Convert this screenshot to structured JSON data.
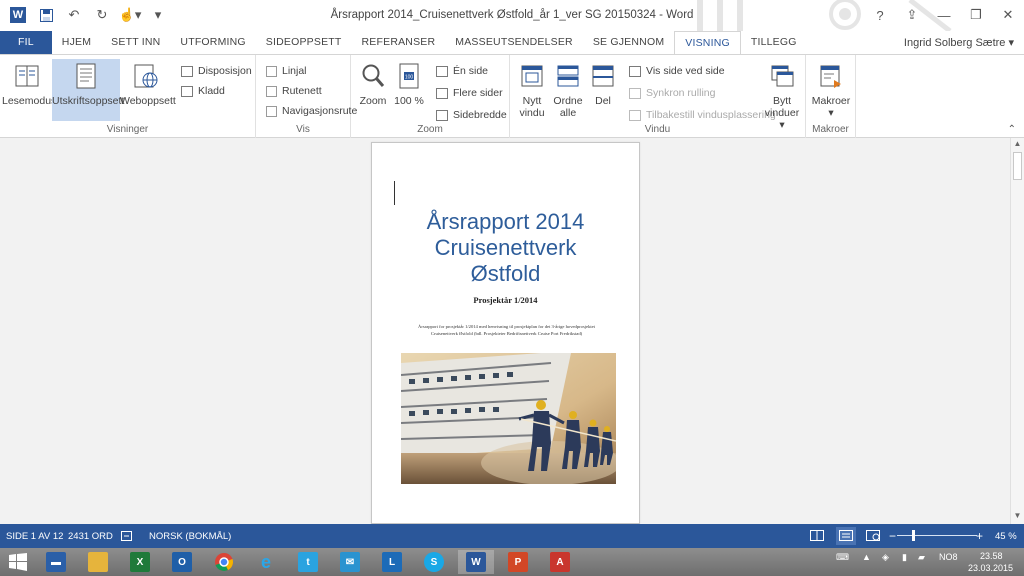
{
  "window": {
    "title": "Årsrapport 2014_Cruisenettverk Østfold_år 1_ver SG 20150324 - Word",
    "buttons": {
      "help": "?",
      "ribbon_display": "⇪",
      "minimize": "—",
      "maximize": "❐",
      "close": "✕"
    }
  },
  "qat": {
    "word_logo": "W",
    "save_icon": "save-icon",
    "undo": "↶",
    "redo": "↻",
    "touch": "☝▾",
    "customize": "▾"
  },
  "tabs": [
    "FIL",
    "HJEM",
    "SETT INN",
    "UTFORMING",
    "SIDEOPPSETT",
    "REFERANSER",
    "MASSEUTSENDELSER",
    "SE GJENNOM",
    "VISNING",
    "TILLEGG"
  ],
  "active_tab": "VISNING",
  "user": "Ingrid Solberg Sætre ▾",
  "ribbon": {
    "visninger": {
      "label": "Visninger",
      "lesemodus": "Lesemodus",
      "utskrift": "Utskriftsoppsett",
      "web": "Weboppsett",
      "disposisjon": "Disposisjon",
      "kladd": "Kladd"
    },
    "vis": {
      "label": "Vis",
      "linjal": "Linjal",
      "rutenett": "Rutenett",
      "navigasjonsrute": "Navigasjonsrute"
    },
    "zoom": {
      "label": "Zoom",
      "zoom": "Zoom",
      "hundre": "100 %",
      "en_side": "Én side",
      "flere_sider": "Flere sider",
      "sidebredde": "Sidebredde"
    },
    "vindu": {
      "label": "Vindu",
      "nytt_vindu_1": "Nytt",
      "nytt_vindu_2": "vindu",
      "ordne_1": "Ordne",
      "ordne_2": "alle",
      "del": "Del",
      "vis_side_ved_side": "Vis side ved side",
      "synkron": "Synkron rulling",
      "tilbakestill": "Tilbakestill vindusplassering",
      "bytt_1": "Bytt",
      "bytt_2": "vinduer ▾"
    },
    "makroer": {
      "label": "Makroer",
      "makroer": "Makroer",
      "arrow": "▾"
    },
    "collapse": "⌃"
  },
  "document": {
    "title_line1": "Årsrapport 2014",
    "title_line2": "Cruisenettverk",
    "title_line3": "Østfold",
    "subtitle": "Prosjektår 1/2014",
    "description": "Årsrapport for prosjektår 1/2014 med henvisning til prosjektplan for det 3-årige hovedprosjektet Cruisenettverk Østfold (bdl. Prosjekteier Bedriftsnettverk Cruise Port Fredrikstad)"
  },
  "status": {
    "page": "SIDE 1 AV 12",
    "words": "2431 ORD",
    "language": "NORSK (BOKMÅL)",
    "zoom_minus": "−",
    "zoom_plus": "+",
    "zoom_level": "45 %",
    "zoom_fraction": 0.2
  },
  "taskbar": {
    "apps": [
      "start-button",
      "desktop-icon",
      "file-explorer-icon",
      "excel-icon",
      "outlook-icon",
      "chrome-icon",
      "internet-explorer-icon",
      "twitter-icon",
      "mail-icon",
      "lync-icon",
      "skype-icon",
      "word-icon",
      "powerpoint-icon",
      "acrobat-icon"
    ],
    "lang": "NO8",
    "time": "23.58",
    "date": "23.03.2015"
  }
}
